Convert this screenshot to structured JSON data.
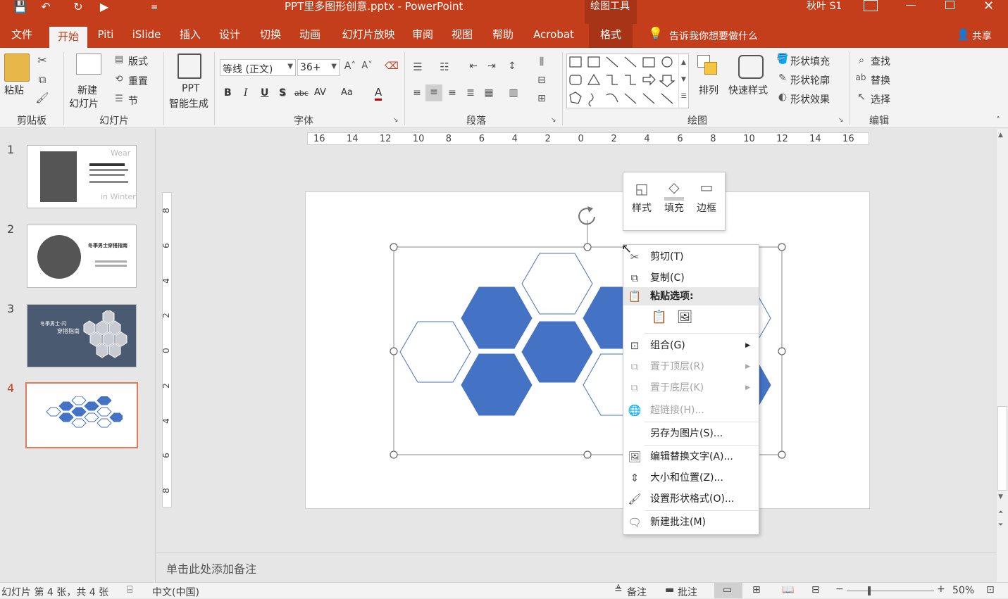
{
  "window": {
    "title": "PPT里多图形创意.pptx  -  PowerPoint",
    "context_tool": "绘图工具",
    "user": "秋叶 S1"
  },
  "qat": {
    "save": "💾",
    "undo": "↶",
    "redo": "↻",
    "present": "▶",
    "more": "≡"
  },
  "tabs": [
    "文件",
    "开始",
    "Piti",
    "iSlide",
    "插入",
    "设计",
    "切换",
    "动画",
    "幻灯片放映",
    "审阅",
    "视图",
    "帮助",
    "Acrobat",
    "格式"
  ],
  "tell_me": "告诉我你想要做什么",
  "share": "共享",
  "ribbon": {
    "clipboard": {
      "paste": "粘贴",
      "label": "剪贴板"
    },
    "slides": {
      "new_slide_line1": "新建",
      "new_slide_line2": "幻灯片",
      "layout": "版式",
      "reset": "重置",
      "section": "节",
      "label": "幻灯片"
    },
    "ppt": {
      "line1": "PPT",
      "line2": "智能生成"
    },
    "font": {
      "font_name": "等线 (正文)",
      "font_size": "36+",
      "label": "字体",
      "bold": "B",
      "italic": "I",
      "underline": "U",
      "shadow": "S",
      "strike": "abc",
      "spacing": "AV",
      "case": "Aa",
      "color": "A"
    },
    "paragraph": {
      "label": "段落"
    },
    "drawing": {
      "arrange": "排列",
      "quick_styles": "快速样式",
      "fill": "形状填充",
      "outline": "形状轮廓",
      "effects": "形状效果",
      "label": "绘图"
    },
    "editing": {
      "find": "查找",
      "replace": "替换",
      "select": "选择",
      "label": "编辑"
    }
  },
  "thumbnails": [
    {
      "num": "1",
      "text1": "Wear",
      "text2": "in Winter"
    },
    {
      "num": "2",
      "text1": "冬季男士穿搭指南"
    },
    {
      "num": "3",
      "text1": "冬季男士·闪",
      "text2": "穿搭指南"
    },
    {
      "num": "4"
    }
  ],
  "ruler_h": [
    "16",
    "14",
    "12",
    "10",
    "8",
    "6",
    "4",
    "2",
    "0",
    "2",
    "4",
    "6",
    "8",
    "10",
    "12",
    "14",
    "16"
  ],
  "ruler_v": [
    "8",
    "6",
    "4",
    "2",
    "0",
    "2",
    "4",
    "6",
    "8"
  ],
  "mini_toolbar": [
    {
      "label": "样式"
    },
    {
      "label": "填充"
    },
    {
      "label": "边框"
    }
  ],
  "context_menu": {
    "cut": "剪切(T)",
    "copy": "复制(C)",
    "paste_header": "粘贴选项:",
    "group": "组合(G)",
    "bring_front": "置于顶层(R)",
    "send_back": "置于底层(K)",
    "hyperlink": "超链接(H)...",
    "save_picture": "另存为图片(S)...",
    "alt_text": "编辑替换文字(A)...",
    "size_position": "大小和位置(Z)...",
    "format_shape": "设置形状格式(O)...",
    "new_comment": "新建批注(M)"
  },
  "notes_placeholder": "单击此处添加备注",
  "status": {
    "slide_info": "幻灯片 第 4 张，共 4 张",
    "language": "中文(中国)",
    "notes": "备注",
    "comments": "批注",
    "zoom": "50%",
    "zoom_fraction": 0.5
  },
  "colors": {
    "accent": "#c43e1c",
    "hex_fill": "#4472c4",
    "hex_stroke": "#4472c4"
  }
}
